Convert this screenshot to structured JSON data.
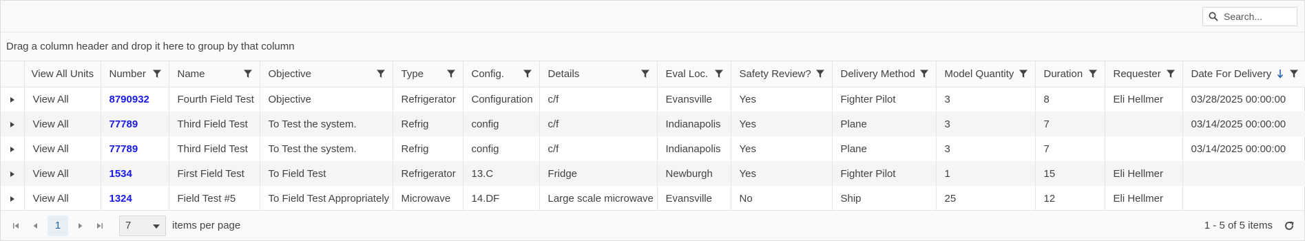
{
  "search": {
    "placeholder": "Search..."
  },
  "group_panel": {
    "text": "Drag a column header and drop it here to group by that column"
  },
  "columns": [
    {
      "label": ""
    },
    {
      "label": "View All Units"
    },
    {
      "label": "Number"
    },
    {
      "label": "Name"
    },
    {
      "label": "Objective"
    },
    {
      "label": "Type"
    },
    {
      "label": "Config."
    },
    {
      "label": "Details"
    },
    {
      "label": "Eval Loc."
    },
    {
      "label": "Safety Review?"
    },
    {
      "label": "Delivery Method"
    },
    {
      "label": "Model Quantity"
    },
    {
      "label": "Duration"
    },
    {
      "label": "Requester"
    },
    {
      "label": "Date For Delivery",
      "sort": "descending"
    }
  ],
  "rows": [
    {
      "view": "View All",
      "number": "8790932",
      "name": "Fourth Field Test",
      "objective": "Objective",
      "type": "Refrigerator",
      "config": "Configuration",
      "details": "c/f",
      "eval_loc": "Evansville",
      "safety": "Yes",
      "delivery": "Fighter Pilot",
      "quantity": "3",
      "duration": "8",
      "requester": "Eli Hellmer",
      "date": "03/28/2025 00:00:00"
    },
    {
      "view": "View All",
      "number": "77789",
      "name": "Third Field Test",
      "objective": "To Test the system.",
      "type": "Refrig",
      "config": "config",
      "details": "c/f",
      "eval_loc": "Indianapolis",
      "safety": "Yes",
      "delivery": "Plane",
      "quantity": "3",
      "duration": "7",
      "requester": "",
      "date": "03/14/2025 00:00:00"
    },
    {
      "view": "View All",
      "number": "77789",
      "name": "Third Field Test",
      "objective": "To Test the system.",
      "type": "Refrig",
      "config": "config",
      "details": "c/f",
      "eval_loc": "Indianapolis",
      "safety": "Yes",
      "delivery": "Plane",
      "quantity": "3",
      "duration": "7",
      "requester": "",
      "date": "03/14/2025 00:00:00"
    },
    {
      "view": "View All",
      "number": "1534",
      "name": "First Field Test",
      "objective": "To Field Test",
      "type": "Refrigerator",
      "config": "13.C",
      "details": "Fridge",
      "eval_loc": "Newburgh",
      "safety": "Yes",
      "delivery": "Fighter Pilot",
      "quantity": "1",
      "duration": "15",
      "requester": "Eli Hellmer",
      "date": ""
    },
    {
      "view": "View All",
      "number": "1324",
      "name": "Field Test #5",
      "objective": "To Field Test Appropriately",
      "type": "Microwave",
      "config": "14.DF",
      "details": "Large scale microwave",
      "eval_loc": "Evansville",
      "safety": "No",
      "delivery": "Ship",
      "quantity": "25",
      "duration": "12",
      "requester": "Eli Hellmer",
      "date": ""
    }
  ],
  "pager": {
    "current_page": "1",
    "page_size": "7",
    "items_per_page_label": "items per page",
    "info": "1 - 5 of 5 items"
  },
  "colors": {
    "link": "#1a1ae6",
    "sort_arrow": "#2563b8",
    "pager_active_bg": "#e8eef5"
  }
}
